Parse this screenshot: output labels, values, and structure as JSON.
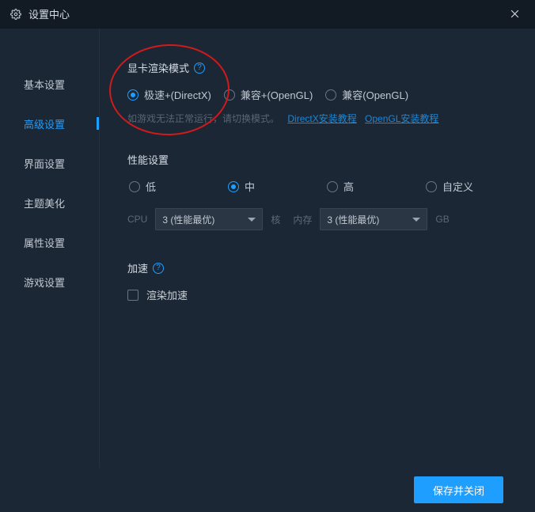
{
  "window": {
    "title": "设置中心"
  },
  "sidebar": {
    "items": [
      {
        "label": "基本设置"
      },
      {
        "label": "高级设置"
      },
      {
        "label": "界面设置"
      },
      {
        "label": "主题美化"
      },
      {
        "label": "属性设置"
      },
      {
        "label": "游戏设置"
      }
    ],
    "activeIndex": 1
  },
  "gpu": {
    "title": "显卡渲染模式",
    "options": [
      {
        "label": "极速+(DirectX)"
      },
      {
        "label": "兼容+(OpenGL)"
      },
      {
        "label": "兼容(OpenGL)"
      }
    ],
    "selectedIndex": 0,
    "hint": "如游戏无法正常运行，请切换模式。",
    "link1": "DirectX安装教程",
    "link2": "OpenGL安装教程"
  },
  "perf": {
    "title": "性能设置",
    "options": [
      {
        "label": "低"
      },
      {
        "label": "中"
      },
      {
        "label": "高"
      },
      {
        "label": "自定义"
      }
    ],
    "selectedIndex": 1,
    "cpuLabel": "CPU",
    "cpuValue": "3 (性能最优)",
    "cpuUnit": "核",
    "memLabel": "内存",
    "memValue": "3 (性能最优)",
    "memUnit": "GB"
  },
  "accel": {
    "title": "加速",
    "checkboxLabel": "渲染加速",
    "checked": false
  },
  "footer": {
    "saveClose": "保存并关闭"
  }
}
